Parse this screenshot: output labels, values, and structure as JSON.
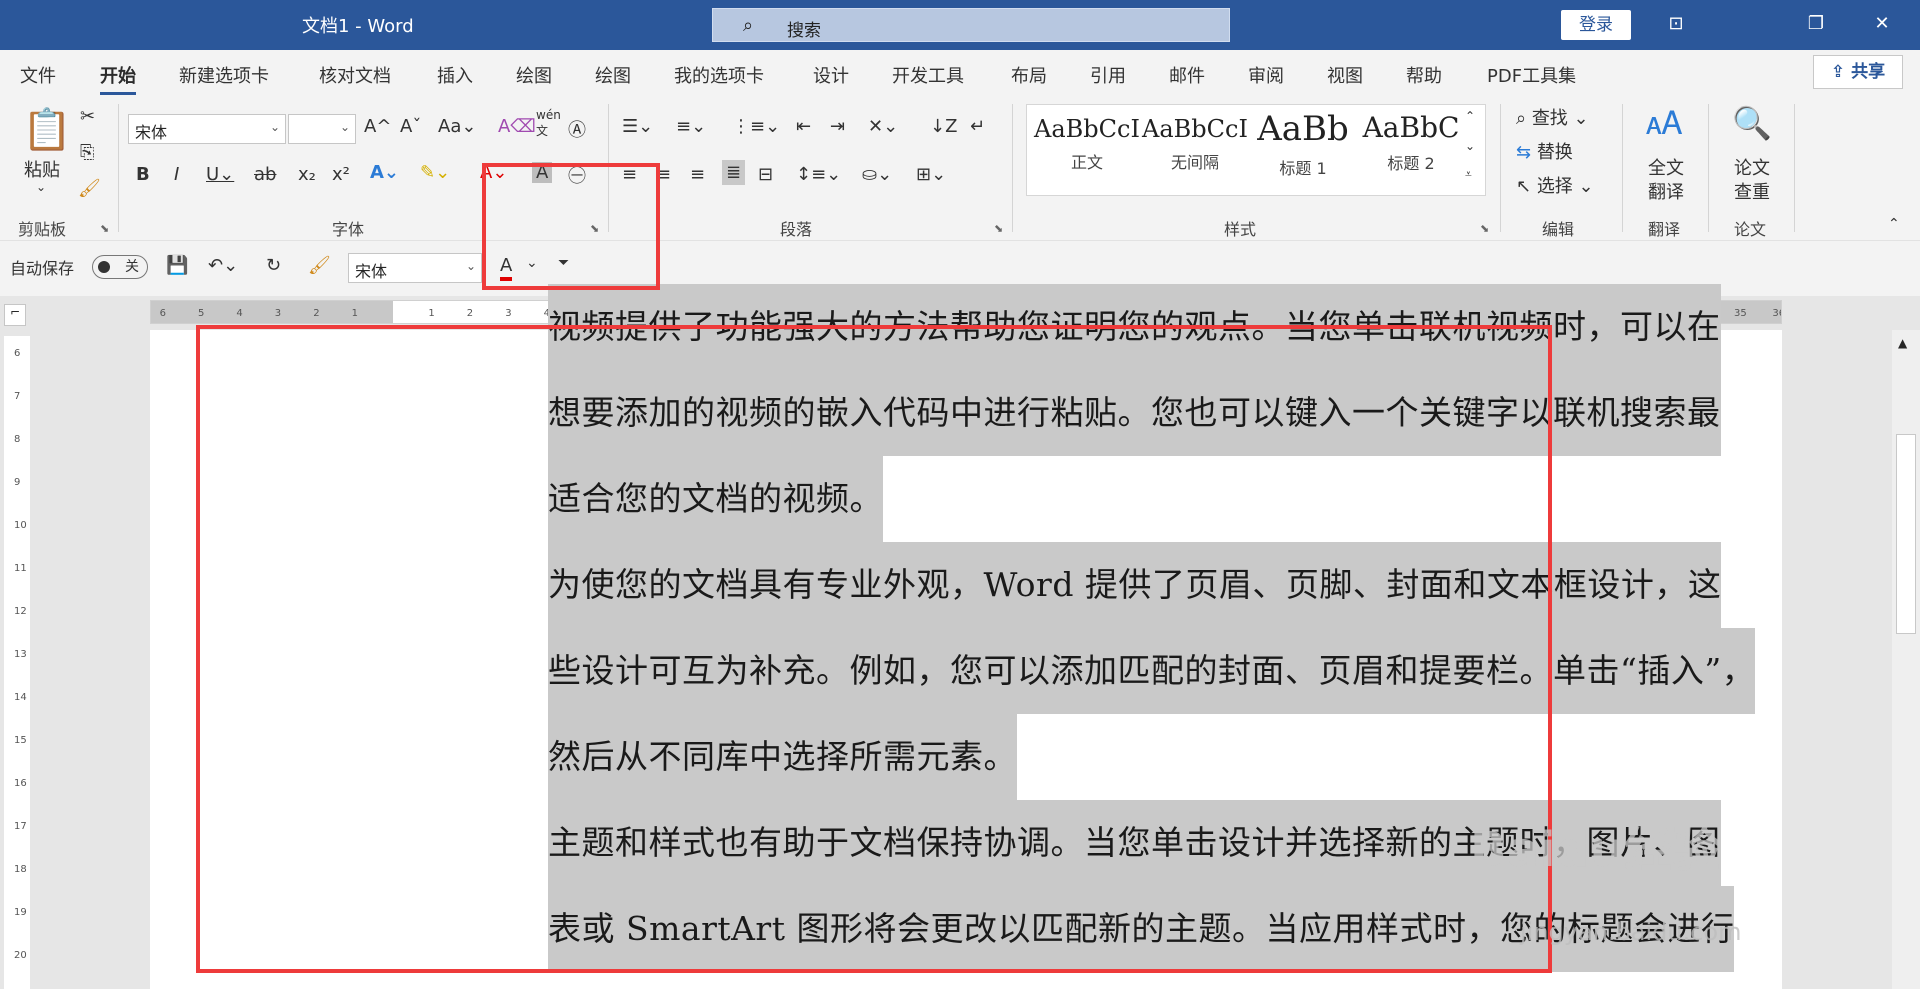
{
  "window": {
    "title": "文档1  -  Word",
    "search_label": "搜索",
    "login_label": "登录"
  },
  "tabs": [
    "文件",
    "开始",
    "新建选项卡",
    "核对文档",
    "插入",
    "绘图",
    "绘图",
    "我的选项卡",
    "设计",
    "开发工具",
    "布局",
    "引用",
    "邮件",
    "审阅",
    "视图",
    "帮助",
    "PDF工具集"
  ],
  "share_label": "共享",
  "ribbon": {
    "clipboard": {
      "paste": "粘贴",
      "group": "剪贴板"
    },
    "font": {
      "font_name": "宋体",
      "font_size": "",
      "group": "字体",
      "pinyin": "wén"
    },
    "paragraph": {
      "group": "段落"
    },
    "styles": {
      "group": "样式",
      "items": [
        {
          "sample": "AaBbCcI",
          "name": "正文"
        },
        {
          "sample": "AaBbCcI",
          "name": "无间隔"
        },
        {
          "sample": "AaBb",
          "name": "标题 1"
        },
        {
          "sample": "AaBbC",
          "name": "标题 2"
        }
      ]
    },
    "editing": {
      "find": "查找",
      "replace": "替换",
      "select": "选择",
      "group": "编辑"
    },
    "translate": {
      "label1": "全文",
      "label2": "翻译",
      "group": "翻译"
    },
    "paper": {
      "label1": "论文",
      "label2": "查重",
      "group": "论文"
    }
  },
  "qat": {
    "autosave": "自动保存",
    "toggle": "关",
    "font_name": "宋体"
  },
  "document": {
    "lines": [
      "视频提供了功能强大的方法帮助您证明您的观点。当您单击联机视频时，可以在",
      "想要添加的视频的嵌入代码中进行粘贴。您也可以键入一个关键字以联机搜索最",
      "适合您的文档的视频。",
      "为使您的文档具有专业外观，Word 提供了页眉、页脚、封面和文本框设计，这",
      "些设计可互为补充。例如，您可以添加匹配的封面、页眉和提要栏。单击“插入”，",
      "然后从不同库中选择所需元素。",
      "主题和样式也有助于文档保持协调。当您单击设计并选择新的主题时，图片、图",
      "表或 SmartArt 图形将会更改以匹配新的主题。当应用样式时，您的标题会进行"
    ]
  },
  "watermark": {
    "brand": "Baidu经验",
    "url": "jingyan.baidu.com"
  },
  "colors": {
    "title_bar": "#2b579a",
    "highlight_box": "#ee3b3b",
    "selection": "#c9c9c9"
  }
}
